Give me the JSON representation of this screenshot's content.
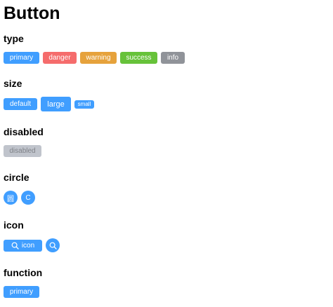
{
  "page": {
    "title": "Button"
  },
  "sections": {
    "type": {
      "title": "type",
      "buttons": [
        "primary",
        "danger",
        "warning",
        "success",
        "info"
      ]
    },
    "size": {
      "title": "size",
      "buttons": [
        "default",
        "large",
        "small"
      ]
    },
    "disabled": {
      "title": "disabled",
      "button": "disabled"
    },
    "circle": {
      "title": "circle",
      "buttons": [
        "圆",
        "C"
      ]
    },
    "icon": {
      "title": "icon",
      "button": "icon",
      "icon_name": "search-icon"
    },
    "function": {
      "title": "function",
      "button": "primary"
    }
  },
  "colors": {
    "primary": "#409eff",
    "danger": "#f56c6c",
    "warning": "#e6a23c",
    "success": "#67c23a",
    "info": "#909399",
    "disabled": "#c0c4cc"
  }
}
